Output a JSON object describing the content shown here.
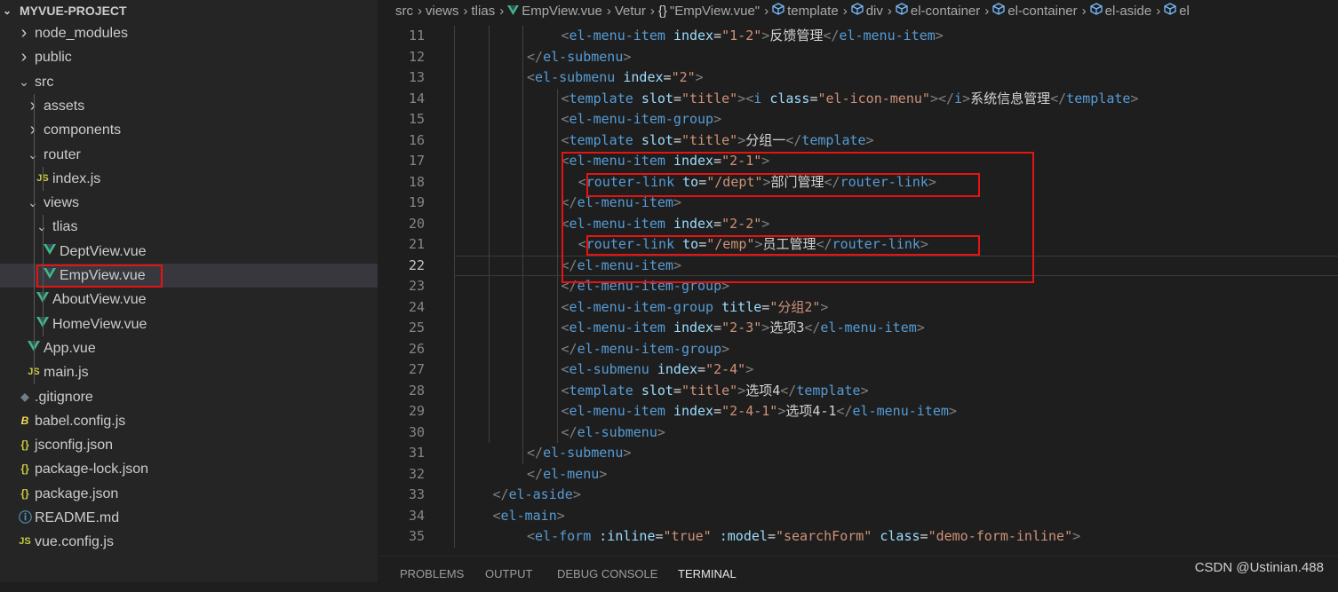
{
  "explorer": {
    "project_title": "MYVUE-PROJECT",
    "items": [
      {
        "label": "node_modules",
        "depth": 0,
        "kind": "folder",
        "expanded": false
      },
      {
        "label": "public",
        "depth": 0,
        "kind": "folder",
        "expanded": false
      },
      {
        "label": "src",
        "depth": 0,
        "kind": "folder",
        "expanded": true
      },
      {
        "label": "assets",
        "depth": 1,
        "kind": "folder",
        "expanded": false
      },
      {
        "label": "components",
        "depth": 1,
        "kind": "folder",
        "expanded": false
      },
      {
        "label": "router",
        "depth": 1,
        "kind": "folder",
        "expanded": true
      },
      {
        "label": "index.js",
        "depth": 2,
        "kind": "js",
        "icon_text": "JS"
      },
      {
        "label": "views",
        "depth": 1,
        "kind": "folder",
        "expanded": true
      },
      {
        "label": "tlias",
        "depth": 2,
        "kind": "folder",
        "expanded": true
      },
      {
        "label": "DeptView.vue",
        "depth": 3,
        "kind": "vue"
      },
      {
        "label": "EmpView.vue",
        "depth": 3,
        "kind": "vue",
        "selected": true,
        "highlighted": true
      },
      {
        "label": "AboutView.vue",
        "depth": 2,
        "kind": "vue"
      },
      {
        "label": "HomeView.vue",
        "depth": 2,
        "kind": "vue"
      },
      {
        "label": "App.vue",
        "depth": 1,
        "kind": "vue"
      },
      {
        "label": "main.js",
        "depth": 1,
        "kind": "js",
        "icon_text": "JS"
      },
      {
        "label": ".gitignore",
        "depth": 0,
        "kind": "git"
      },
      {
        "label": "babel.config.js",
        "depth": 0,
        "kind": "babel"
      },
      {
        "label": "jsconfig.json",
        "depth": 0,
        "kind": "json",
        "icon_text": "{}"
      },
      {
        "label": "package-lock.json",
        "depth": 0,
        "kind": "json",
        "icon_text": "{}"
      },
      {
        "label": "package.json",
        "depth": 0,
        "kind": "json",
        "icon_text": "{}"
      },
      {
        "label": "README.md",
        "depth": 0,
        "kind": "info"
      },
      {
        "label": "vue.config.js",
        "depth": 0,
        "kind": "js",
        "icon_text": "JS"
      }
    ]
  },
  "breadcrumb": {
    "items": [
      {
        "text": "src",
        "icon": ""
      },
      {
        "text": "views",
        "icon": ""
      },
      {
        "text": "tlias",
        "icon": ""
      },
      {
        "text": "EmpView.vue",
        "icon": "vue-icon"
      },
      {
        "text": "Vetur",
        "icon": ""
      },
      {
        "text": "\"EmpView.vue\"",
        "icon": "braces-icon"
      },
      {
        "text": "template",
        "icon": "cube-icon"
      },
      {
        "text": "div",
        "icon": "cube-icon"
      },
      {
        "text": "el-container",
        "icon": "cube-icon"
      },
      {
        "text": "el-container",
        "icon": "cube-icon"
      },
      {
        "text": "el-aside",
        "icon": "cube-icon"
      },
      {
        "text": "el",
        "icon": "cube-icon"
      }
    ],
    "braces_glyph": "{}"
  },
  "editor": {
    "active_line": 22,
    "lines": [
      {
        "n": 11,
        "indent": 3,
        "tokens": [
          [
            "p",
            "<"
          ],
          [
            "tag",
            "el-menu-item"
          ],
          [
            "sp",
            " "
          ],
          [
            "attr",
            "index"
          ],
          [
            "eq",
            "="
          ],
          [
            "str",
            "\"1-2\""
          ],
          [
            "p",
            ">"
          ],
          [
            "text",
            "反馈管理"
          ],
          [
            "p",
            "</"
          ],
          [
            "tag",
            "el-menu-item"
          ],
          [
            "p",
            ">"
          ]
        ]
      },
      {
        "n": 12,
        "indent": 2,
        "tokens": [
          [
            "p",
            "</"
          ],
          [
            "tag",
            "el-submenu"
          ],
          [
            "p",
            ">"
          ]
        ]
      },
      {
        "n": 13,
        "indent": 2,
        "tokens": [
          [
            "p",
            "<"
          ],
          [
            "tag",
            "el-submenu"
          ],
          [
            "sp",
            " "
          ],
          [
            "attr",
            "index"
          ],
          [
            "eq",
            "="
          ],
          [
            "str",
            "\"2\""
          ],
          [
            "p",
            ">"
          ]
        ]
      },
      {
        "n": 14,
        "indent": 3,
        "tokens": [
          [
            "p",
            "<"
          ],
          [
            "tag",
            "template"
          ],
          [
            "sp",
            " "
          ],
          [
            "attr",
            "slot"
          ],
          [
            "eq",
            "="
          ],
          [
            "str",
            "\"title\""
          ],
          [
            "p",
            "><"
          ],
          [
            "tag",
            "i"
          ],
          [
            "sp",
            " "
          ],
          [
            "attr",
            "class"
          ],
          [
            "eq",
            "="
          ],
          [
            "str",
            "\"el-icon-menu\""
          ],
          [
            "p",
            "></"
          ],
          [
            "tag",
            "i"
          ],
          [
            "p",
            ">"
          ],
          [
            "text",
            "系统信息管理"
          ],
          [
            "p",
            "</"
          ],
          [
            "tag",
            "template"
          ],
          [
            "p",
            ">"
          ]
        ]
      },
      {
        "n": 15,
        "indent": 3,
        "tokens": [
          [
            "p",
            "<"
          ],
          [
            "tag",
            "el-menu-item-group"
          ],
          [
            "p",
            ">"
          ]
        ]
      },
      {
        "n": 16,
        "indent": 3,
        "tokens": [
          [
            "p",
            "<"
          ],
          [
            "tag",
            "template"
          ],
          [
            "sp",
            " "
          ],
          [
            "attr",
            "slot"
          ],
          [
            "eq",
            "="
          ],
          [
            "str",
            "\"title\""
          ],
          [
            "p",
            ">"
          ],
          [
            "text",
            "分组一"
          ],
          [
            "p",
            "</"
          ],
          [
            "tag",
            "template"
          ],
          [
            "p",
            ">"
          ]
        ]
      },
      {
        "n": 17,
        "indent": 3,
        "tokens": [
          [
            "p",
            "<"
          ],
          [
            "tag",
            "el-menu-item"
          ],
          [
            "sp",
            " "
          ],
          [
            "attr",
            "index"
          ],
          [
            "eq",
            "="
          ],
          [
            "str",
            "\"2-1\""
          ],
          [
            "p",
            ">"
          ]
        ]
      },
      {
        "n": 18,
        "indent": 3.5,
        "tokens": [
          [
            "p",
            "<"
          ],
          [
            "tag",
            "router-link"
          ],
          [
            "sp",
            " "
          ],
          [
            "attr",
            "to"
          ],
          [
            "eq",
            "="
          ],
          [
            "str",
            "\"/dept\""
          ],
          [
            "p",
            ">"
          ],
          [
            "text",
            "部门管理"
          ],
          [
            "p",
            "</"
          ],
          [
            "tag",
            "router-link"
          ],
          [
            "p",
            ">"
          ]
        ]
      },
      {
        "n": 19,
        "indent": 3,
        "tokens": [
          [
            "p",
            "</"
          ],
          [
            "tag",
            "el-menu-item"
          ],
          [
            "p",
            ">"
          ]
        ]
      },
      {
        "n": 20,
        "indent": 3,
        "tokens": [
          [
            "p",
            "<"
          ],
          [
            "tag",
            "el-menu-item"
          ],
          [
            "sp",
            " "
          ],
          [
            "attr",
            "index"
          ],
          [
            "eq",
            "="
          ],
          [
            "str",
            "\"2-2\""
          ],
          [
            "p",
            ">"
          ]
        ]
      },
      {
        "n": 21,
        "indent": 3.5,
        "tokens": [
          [
            "p",
            "<"
          ],
          [
            "tag",
            "router-link"
          ],
          [
            "sp",
            " "
          ],
          [
            "attr",
            "to"
          ],
          [
            "eq",
            "="
          ],
          [
            "str",
            "\"/emp\""
          ],
          [
            "p",
            ">"
          ],
          [
            "text",
            "员工管理"
          ],
          [
            "p",
            "</"
          ],
          [
            "tag",
            "router-link"
          ],
          [
            "p",
            ">"
          ]
        ]
      },
      {
        "n": 22,
        "indent": 3,
        "tokens": [
          [
            "p",
            "</"
          ],
          [
            "tag",
            "el-menu-item"
          ],
          [
            "p",
            ">"
          ]
        ]
      },
      {
        "n": 23,
        "indent": 3,
        "tokens": [
          [
            "p",
            "</"
          ],
          [
            "tag",
            "el-menu-item-group"
          ],
          [
            "p",
            ">"
          ]
        ]
      },
      {
        "n": 24,
        "indent": 3,
        "tokens": [
          [
            "p",
            "<"
          ],
          [
            "tag",
            "el-menu-item-group"
          ],
          [
            "sp",
            " "
          ],
          [
            "attr",
            "title"
          ],
          [
            "eq",
            "="
          ],
          [
            "str",
            "\"分组2\""
          ],
          [
            "p",
            ">"
          ]
        ]
      },
      {
        "n": 25,
        "indent": 3,
        "tokens": [
          [
            "p",
            "<"
          ],
          [
            "tag",
            "el-menu-item"
          ],
          [
            "sp",
            " "
          ],
          [
            "attr",
            "index"
          ],
          [
            "eq",
            "="
          ],
          [
            "str",
            "\"2-3\""
          ],
          [
            "p",
            ">"
          ],
          [
            "text",
            "选项3"
          ],
          [
            "p",
            "</"
          ],
          [
            "tag",
            "el-menu-item"
          ],
          [
            "p",
            ">"
          ]
        ]
      },
      {
        "n": 26,
        "indent": 3,
        "tokens": [
          [
            "p",
            "</"
          ],
          [
            "tag",
            "el-menu-item-group"
          ],
          [
            "p",
            ">"
          ]
        ]
      },
      {
        "n": 27,
        "indent": 3,
        "tokens": [
          [
            "p",
            "<"
          ],
          [
            "tag",
            "el-submenu"
          ],
          [
            "sp",
            " "
          ],
          [
            "attr",
            "index"
          ],
          [
            "eq",
            "="
          ],
          [
            "str",
            "\"2-4\""
          ],
          [
            "p",
            ">"
          ]
        ]
      },
      {
        "n": 28,
        "indent": 3,
        "tokens": [
          [
            "p",
            "<"
          ],
          [
            "tag",
            "template"
          ],
          [
            "sp",
            " "
          ],
          [
            "attr",
            "slot"
          ],
          [
            "eq",
            "="
          ],
          [
            "str",
            "\"title\""
          ],
          [
            "p",
            ">"
          ],
          [
            "text",
            "选项4"
          ],
          [
            "p",
            "</"
          ],
          [
            "tag",
            "template"
          ],
          [
            "p",
            ">"
          ]
        ]
      },
      {
        "n": 29,
        "indent": 3,
        "tokens": [
          [
            "p",
            "<"
          ],
          [
            "tag",
            "el-menu-item"
          ],
          [
            "sp",
            " "
          ],
          [
            "attr",
            "index"
          ],
          [
            "eq",
            "="
          ],
          [
            "str",
            "\"2-4-1\""
          ],
          [
            "p",
            ">"
          ],
          [
            "text",
            "选项4-1"
          ],
          [
            "p",
            "</"
          ],
          [
            "tag",
            "el-menu-item"
          ],
          [
            "p",
            ">"
          ]
        ]
      },
      {
        "n": 30,
        "indent": 3,
        "tokens": [
          [
            "p",
            "</"
          ],
          [
            "tag",
            "el-submenu"
          ],
          [
            "p",
            ">"
          ]
        ]
      },
      {
        "n": 31,
        "indent": 2,
        "tokens": [
          [
            "p",
            "</"
          ],
          [
            "tag",
            "el-submenu"
          ],
          [
            "p",
            ">"
          ]
        ]
      },
      {
        "n": 32,
        "indent": 2,
        "tokens": [
          [
            "p",
            "</"
          ],
          [
            "tag",
            "el-menu"
          ],
          [
            "p",
            ">"
          ]
        ]
      },
      {
        "n": 33,
        "indent": 1,
        "tokens": [
          [
            "p",
            "</"
          ],
          [
            "tag",
            "el-aside"
          ],
          [
            "p",
            ">"
          ]
        ]
      },
      {
        "n": 34,
        "indent": 1,
        "tokens": [
          [
            "p",
            "<"
          ],
          [
            "tag",
            "el-main"
          ],
          [
            "p",
            ">"
          ]
        ]
      },
      {
        "n": 35,
        "indent": 2,
        "tokens": [
          [
            "p",
            "<"
          ],
          [
            "tag",
            "el-form"
          ],
          [
            "sp",
            " "
          ],
          [
            "attr",
            ":inline"
          ],
          [
            "eq",
            "="
          ],
          [
            "str",
            "\"true\""
          ],
          [
            "sp",
            " "
          ],
          [
            "attr",
            ":model"
          ],
          [
            "eq",
            "="
          ],
          [
            "str",
            "\"searchForm\""
          ],
          [
            "sp",
            " "
          ],
          [
            "attr",
            "class"
          ],
          [
            "eq",
            "="
          ],
          [
            "str",
            "\"demo-form-inline\""
          ],
          [
            "p",
            ">"
          ]
        ]
      }
    ]
  },
  "panel": {
    "tabs": [
      "PROBLEMS",
      "OUTPUT",
      "DEBUG CONSOLE",
      "TERMINAL"
    ],
    "active_tab": "TERMINAL"
  },
  "watermark": "CSDN @Ustinian.488",
  "colors": {
    "highlight_box": "#e51414",
    "vue_green": "#41b883",
    "js_yellow": "#cbcb41",
    "json_yellow": "#cbcb41",
    "babel_yellow": "#f5da55",
    "git_gray": "#6d8086",
    "info_blue": "#519aba"
  }
}
